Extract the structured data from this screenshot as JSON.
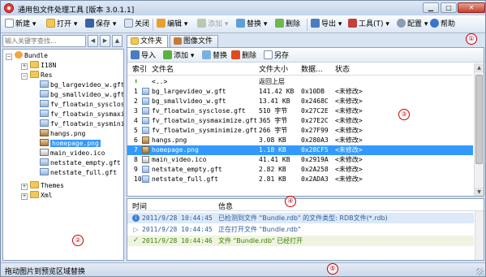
{
  "app": {
    "title": "通用包文件处理工具 [版本 3.0.1.1]",
    "window_buttons": {
      "minimize": "▁",
      "maximize": "□",
      "close": "✕"
    }
  },
  "toolbar": {
    "new": "新建",
    "open": "打开",
    "save": "保存",
    "close": "关闭",
    "edit": "编辑",
    "add": "添加",
    "replace": "替换",
    "delete": "删除",
    "export": "导出",
    "tools": "工具(T)",
    "config": "配置",
    "help": "帮助",
    "dropdown_arrow": "▾"
  },
  "markers": {
    "m1": "①",
    "m2": "②",
    "m3": "③",
    "m4": "④",
    "m5": "⑤"
  },
  "search": {
    "placeholder": "输入关键字查找..."
  },
  "nav": {
    "back": "◀",
    "forward": "▶",
    "up": "▲"
  },
  "tree": {
    "expand": "+",
    "collapse": "−",
    "items": [
      {
        "label": "Bundle"
      },
      {
        "label": "I18N"
      },
      {
        "label": "Res"
      },
      {
        "label": "bg_largevideo_w.gft"
      },
      {
        "label": "bg_smallvideo_w.gft"
      },
      {
        "label": "fv_floatwin_sysclose.gft"
      },
      {
        "label": "fv_floatwin_sysmaximize.gft"
      },
      {
        "label": "fv_floatwin_sysminimize.gft"
      },
      {
        "label": "hangs.png"
      },
      {
        "label": "homepage.png"
      },
      {
        "label": "main_video.ico"
      },
      {
        "label": "netstate_empty.gft"
      },
      {
        "label": "netstate_full.gft"
      },
      {
        "label": "Themes"
      },
      {
        "label": "Xml"
      }
    ]
  },
  "tabs": [
    {
      "label": "文件夹"
    },
    {
      "label": "图像文件"
    }
  ],
  "file_toolbar": {
    "import": "导入",
    "add": "添加",
    "replace": "替换",
    "delete": "删除",
    "save_as": "另存"
  },
  "file_table": {
    "headers": [
      "索引",
      "文件名",
      "文件大小",
      "数据...",
      "状态"
    ],
    "up_row": {
      "name": "<..>",
      "size": "返回上层"
    },
    "rows": [
      {
        "index": "1",
        "name": "bg_largevideo_w.gft",
        "size": "141.42 KB",
        "data": "0x10DB",
        "status": "<未修改>"
      },
      {
        "index": "2",
        "name": "bg_smallvideo_w.gft",
        "size": "13.41 KB",
        "data": "0x2468C",
        "status": "<未修改>"
      },
      {
        "index": "3",
        "name": "fv_floatwin_sysclose.gft",
        "size": "510 字节",
        "data": "0x27C2E",
        "status": "<未修改>"
      },
      {
        "index": "4",
        "name": "fv_floatwin_sysmaximize.gft",
        "size": "365 字节",
        "data": "0x27E2C",
        "status": "<未修改>"
      },
      {
        "index": "5",
        "name": "fv_floatwin_sysminimize.gft",
        "size": "266 字节",
        "data": "0x27F99",
        "status": "<未修改>"
      },
      {
        "index": "6",
        "name": "hangs.png",
        "size": "3.08 KB",
        "data": "0x280A3",
        "status": "<未修改>"
      },
      {
        "index": "7",
        "name": "homepage.png",
        "size": "1.18 KB",
        "data": "0x28CF5",
        "status": "<未修改>"
      },
      {
        "index": "8",
        "name": "main_video.ico",
        "size": "41.41 KB",
        "data": "0x2919A",
        "status": "<未修改>"
      },
      {
        "index": "9",
        "name": "netstate_empty.gft",
        "size": "2.82 KB",
        "data": "0x2A258",
        "status": "<未修改>"
      },
      {
        "index": "10",
        "name": "netstate_full.gft",
        "size": "2.81 KB",
        "data": "0x2ADA3",
        "status": "<未修改>"
      }
    ]
  },
  "log": {
    "headers": {
      "time": "时间",
      "info": "信息"
    },
    "rows": [
      {
        "time": "2011/9/28 10:44:45",
        "message": "已检测到文件 \"Bundle.rdb\" 的文件类型: RDB文件(*.rdb)"
      },
      {
        "time": "2011/9/28 10:44:45",
        "message": "正在打开文件 \"Bundle.rdb\""
      },
      {
        "time": "2011/9/28 10:44:46",
        "message": "文件 \"Bundle.rdb\" 已经打开"
      }
    ]
  },
  "statusbar": {
    "text": "拖动图片到预览区域替换"
  },
  "colors": {
    "selection": "#3399ff",
    "marker": "#cc0000",
    "log_info": "#2a5aa0",
    "log_ok": "#3e7d00"
  }
}
